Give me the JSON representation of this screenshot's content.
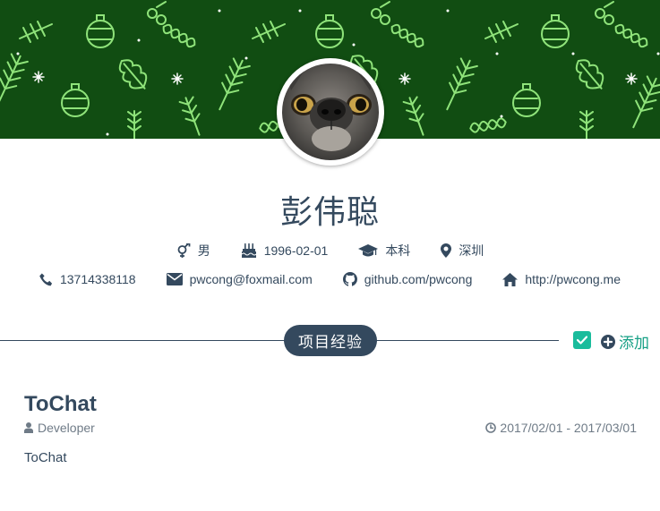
{
  "profile": {
    "name": "彭伟聪",
    "gender": "男",
    "birthday": "1996-02-01",
    "education": "本科",
    "location": "深圳"
  },
  "contacts": {
    "phone": "13714338118",
    "email": "pwcong@foxmail.com",
    "github": "github.com/pwcong",
    "website": "http://pwcong.me"
  },
  "section": {
    "title": "项目经验",
    "add_label": "添加"
  },
  "project": {
    "title": "ToChat",
    "role": "Developer",
    "date_range": "2017/02/01 - 2017/03/01",
    "description": "ToChat"
  },
  "colors": {
    "banner_bg": "#114d12",
    "banner_pattern": "#8fe37a",
    "text_primary": "#34495e",
    "accent": "#1abc9c"
  },
  "icons": [
    "gender-icon",
    "birthday-cake-icon",
    "graduation-cap-icon",
    "map-marker-icon",
    "phone-icon",
    "envelope-icon",
    "github-icon",
    "home-icon",
    "check-icon",
    "plus-circle-icon",
    "user-icon",
    "clock-icon"
  ]
}
